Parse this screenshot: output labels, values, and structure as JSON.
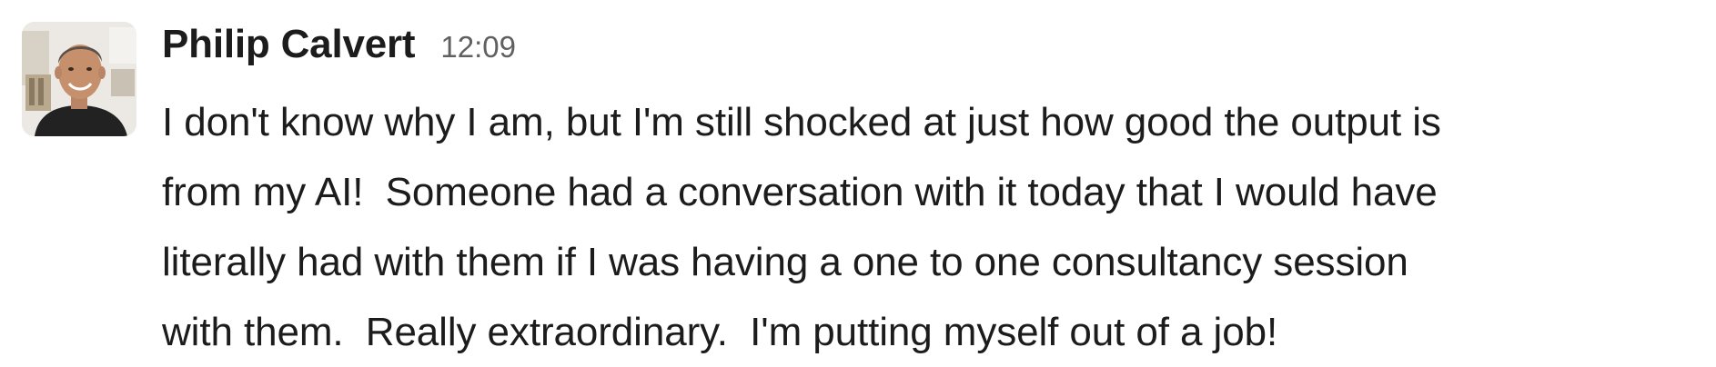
{
  "message": {
    "sender": "Philip Calvert",
    "timestamp": "12:09",
    "avatar_icon": "user-photo-avatar",
    "lines": [
      "I don't know why I am, but I'm still shocked at just how good the output is",
      "from my AI!  Someone had a conversation with it today that I would have",
      "literally had with them if I was having a one to one consultancy session",
      "with them.  Really extraordinary.  I'm putting myself out of a job!"
    ]
  },
  "colors": {
    "text_primary": "#1d1c1d",
    "text_secondary": "#616061",
    "background": "#ffffff"
  }
}
